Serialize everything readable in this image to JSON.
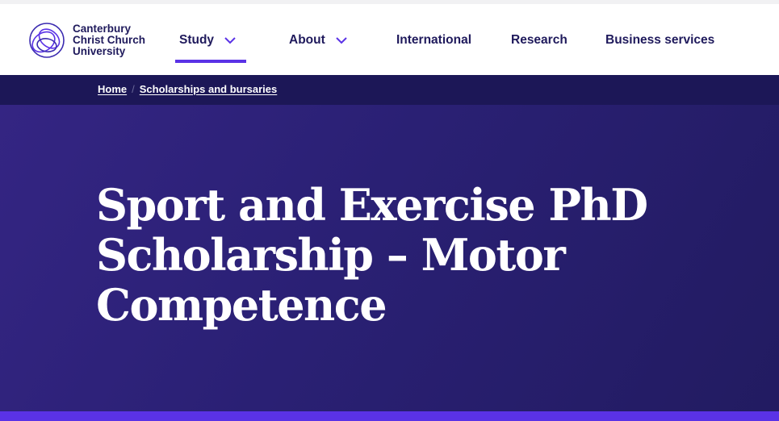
{
  "logo": {
    "text": "Canterbury\nChrist Church\nUniversity",
    "icon": "ccu-loops-logo-icon"
  },
  "nav": {
    "items": [
      {
        "label": "Study",
        "has_dropdown": true,
        "active": true
      },
      {
        "label": "About",
        "has_dropdown": true,
        "active": false
      },
      {
        "label": "International",
        "has_dropdown": false,
        "active": false
      },
      {
        "label": "Research",
        "has_dropdown": false,
        "active": false
      },
      {
        "label": "Business services",
        "has_dropdown": false,
        "active": false
      }
    ]
  },
  "breadcrumb": {
    "items": [
      "Home",
      "Scholarships and bursaries"
    ],
    "separator": "/"
  },
  "hero": {
    "title": "Sport and Exercise PhD Scholarship – Motor Competence"
  },
  "colors": {
    "brand_navy": "#1f1a5c",
    "accent_purple": "#5a32e6",
    "breadcrumb_bar": "#1c1757",
    "hero_bg": "#2a2074"
  }
}
